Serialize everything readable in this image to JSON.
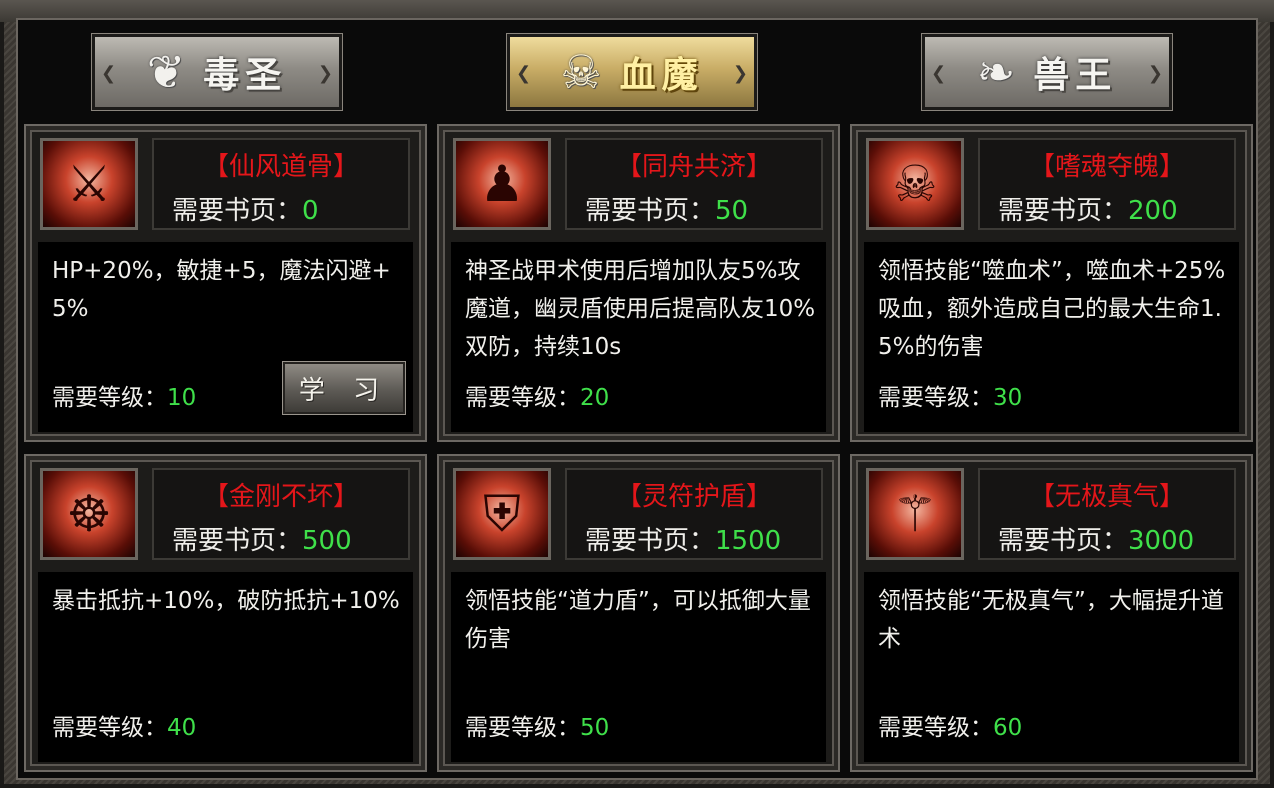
{
  "tabs": [
    {
      "label": "毒圣",
      "active": false,
      "emblem": "❦"
    },
    {
      "label": "血魔",
      "active": true,
      "emblem": "☠"
    },
    {
      "label": "兽王",
      "active": false,
      "emblem": "❧"
    }
  ],
  "labels": {
    "pages_prefix": "需要书页：",
    "level_prefix": "需要等级：",
    "learn_button": "学 习"
  },
  "skills": [
    {
      "name": "【仙风道骨】",
      "pages": "0",
      "desc": "HP+20%，敏捷+5，魔法闪避+5%",
      "level": "10",
      "icon": "sword-slash-icon",
      "glyph": "⚔",
      "learnable": true
    },
    {
      "name": "【同舟共济】",
      "pages": "50",
      "desc": "神圣战甲术使用后增加队友5%攻魔道，幽灵盾使用后提高队友10%双防，持续10s",
      "level": "20",
      "icon": "three-warriors-icon",
      "glyph": "♟",
      "learnable": false
    },
    {
      "name": "【嗜魂夺魄】",
      "pages": "200",
      "desc": "领悟技能“噬血术”，噬血术+25%吸血，额外造成自己的最大生命1.5%的伤害",
      "level": "30",
      "icon": "demon-face-icon",
      "glyph": "☠",
      "learnable": false
    },
    {
      "name": "【金刚不坏】",
      "pages": "500",
      "desc": "暴击抵抗+10%，破防抵抗+10%",
      "level": "40",
      "icon": "meditation-icon",
      "glyph": "☸",
      "learnable": false
    },
    {
      "name": "【灵符护盾】",
      "pages": "1500",
      "desc": "领悟技能“道力盾”，可以抵御大量伤害",
      "level": "50",
      "icon": "shield-icon",
      "glyph": "⛨",
      "learnable": false
    },
    {
      "name": "【无极真气】",
      "pages": "3000",
      "desc": "领悟技能“无极真气”，大幅提升道术",
      "level": "60",
      "icon": "raised-sword-icon",
      "glyph": "⚚",
      "learnable": false
    }
  ]
}
